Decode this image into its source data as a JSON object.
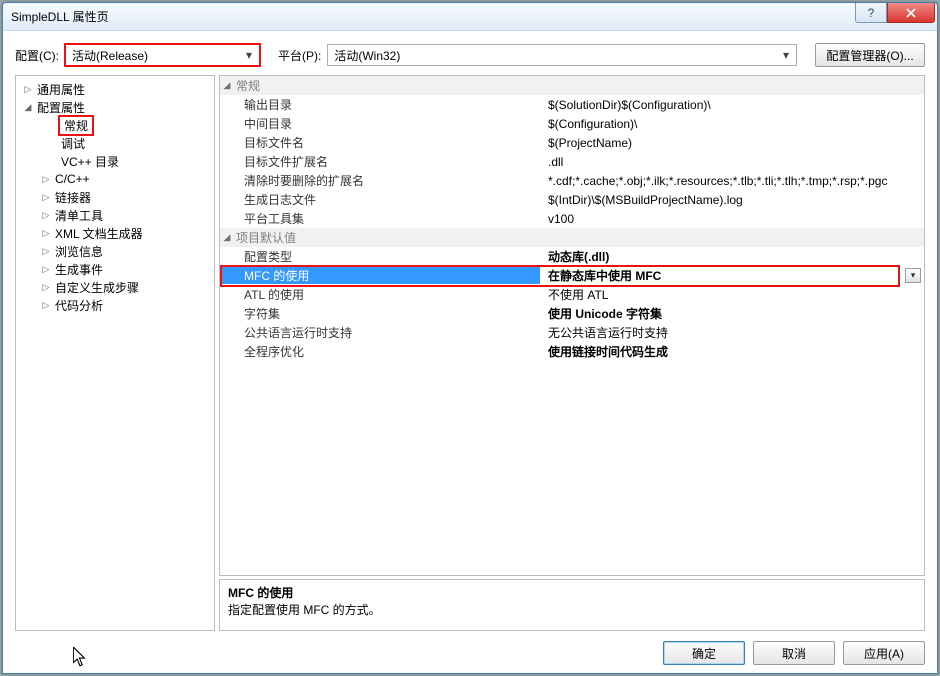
{
  "window": {
    "title": "SimpleDLL 属性页"
  },
  "toolbar": {
    "config_label": "配置(C):",
    "config_value": "活动(Release)",
    "platform_label": "平台(P):",
    "platform_value": "活动(Win32)",
    "config_manager": "配置管理器(O)..."
  },
  "tree": {
    "common": "通用属性",
    "config_props": "配置属性",
    "general": "常规",
    "debug": "调试",
    "vcdir": "VC++ 目录",
    "ccpp": "C/C++",
    "linker": "链接器",
    "manifest": "清单工具",
    "xmldoc": "XML 文档生成器",
    "browse": "浏览信息",
    "buildevents": "生成事件",
    "custom": "自定义生成步骤",
    "codeanalysis": "代码分析"
  },
  "props": {
    "cat_general": "常规",
    "out_dir": {
      "k": "输出目录",
      "v": "$(SolutionDir)$(Configuration)\\"
    },
    "int_dir": {
      "k": "中间目录",
      "v": "$(Configuration)\\"
    },
    "target_name": {
      "k": "目标文件名",
      "v": "$(ProjectName)"
    },
    "target_ext": {
      "k": "目标文件扩展名",
      "v": ".dll"
    },
    "clean_ext": {
      "k": "清除时要删除的扩展名",
      "v": "*.cdf;*.cache;*.obj;*.ilk;*.resources;*.tlb;*.tli;*.tlh;*.tmp;*.rsp;*.pgc"
    },
    "build_log": {
      "k": "生成日志文件",
      "v": "$(IntDir)\\$(MSBuildProjectName).log"
    },
    "toolset": {
      "k": "平台工具集",
      "v": "v100"
    },
    "cat_defaults": "项目默认值",
    "cfg_type": {
      "k": "配置类型",
      "v": "动态库(.dll)"
    },
    "mfc_use": {
      "k": "MFC 的使用",
      "v": "在静态库中使用 MFC"
    },
    "atl_use": {
      "k": "ATL 的使用",
      "v": "不使用 ATL"
    },
    "charset": {
      "k": "字符集",
      "v": "使用 Unicode 字符集"
    },
    "clr": {
      "k": "公共语言运行时支持",
      "v": "无公共语言运行时支持"
    },
    "wpo": {
      "k": "全程序优化",
      "v": "使用链接时间代码生成"
    }
  },
  "desc": {
    "title": "MFC 的使用",
    "text": "指定配置使用 MFC 的方式。"
  },
  "buttons": {
    "ok": "确定",
    "cancel": "取消",
    "apply": "应用(A)"
  },
  "glyph": {
    "tri_right": "▷",
    "tri_down": "◢",
    "chev_down": "▾"
  }
}
